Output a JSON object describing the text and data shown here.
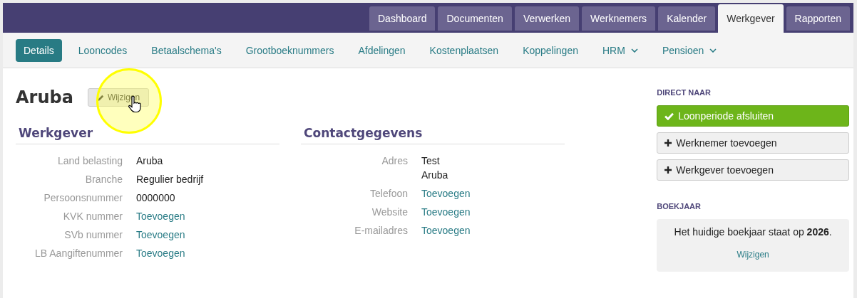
{
  "top_tabs": [
    {
      "label": "Dashboard",
      "selected": false
    },
    {
      "label": "Documenten",
      "selected": false
    },
    {
      "label": "Verwerken",
      "selected": false
    },
    {
      "label": "Werknemers",
      "selected": false
    },
    {
      "label": "Kalender",
      "selected": false
    },
    {
      "label": "Werkgever",
      "selected": true
    },
    {
      "label": "Rapporten",
      "selected": false
    }
  ],
  "sub_nav": [
    {
      "label": "Details",
      "selected": true,
      "dropdown": false
    },
    {
      "label": "Looncodes",
      "selected": false,
      "dropdown": false
    },
    {
      "label": "Betaalschema's",
      "selected": false,
      "dropdown": false
    },
    {
      "label": "Grootboeknummers",
      "selected": false,
      "dropdown": false
    },
    {
      "label": "Afdelingen",
      "selected": false,
      "dropdown": false
    },
    {
      "label": "Kostenplaatsen",
      "selected": false,
      "dropdown": false
    },
    {
      "label": "Koppelingen",
      "selected": false,
      "dropdown": false
    },
    {
      "label": "HRM",
      "selected": false,
      "dropdown": true
    },
    {
      "label": "Pensioen",
      "selected": false,
      "dropdown": true
    }
  ],
  "page_title": "Aruba",
  "edit_button": "Wijzigen",
  "cursor_highlight": true,
  "sections": [
    {
      "title": "Werkgever",
      "fields": [
        {
          "label": "Land belasting",
          "kind": "text",
          "values": [
            "Aruba"
          ]
        },
        {
          "label": "Branche",
          "kind": "text",
          "values": [
            "Regulier bedrijf"
          ]
        },
        {
          "label": "Persoonsnummer",
          "kind": "text",
          "values": [
            "0000000"
          ]
        },
        {
          "label": "KVK nummer",
          "kind": "link",
          "values": [
            "Toevoegen"
          ]
        },
        {
          "label": "SVb nummer",
          "kind": "link",
          "values": [
            "Toevoegen"
          ]
        },
        {
          "label": "LB Aangiftenummer",
          "kind": "link",
          "values": [
            "Toevoegen"
          ]
        }
      ]
    },
    {
      "title": "Contactgegevens",
      "fields": [
        {
          "label": "Adres",
          "kind": "text",
          "values": [
            "Test",
            "Aruba"
          ]
        },
        {
          "label": "Telefoon",
          "kind": "link",
          "values": [
            "Toevoegen"
          ]
        },
        {
          "label": "Website",
          "kind": "link",
          "values": [
            "Toevoegen"
          ]
        },
        {
          "label": "E-mailadres",
          "kind": "link",
          "values": [
            "Toevoegen"
          ]
        }
      ]
    }
  ],
  "sidebar": {
    "direct_heading": "DIRECT NAAR",
    "actions": [
      {
        "label": "Loonperiode afsluiten",
        "kind": "primary"
      },
      {
        "label": "Werknemer toevoegen",
        "kind": "add"
      },
      {
        "label": "Werkgever toevoegen",
        "kind": "add"
      }
    ],
    "boekjaar_heading": "BOEKJAAR",
    "boekjaar_text": "Het huidige boekjaar staat op **2026**.",
    "boekjaar_link": "Wijzigen"
  }
}
